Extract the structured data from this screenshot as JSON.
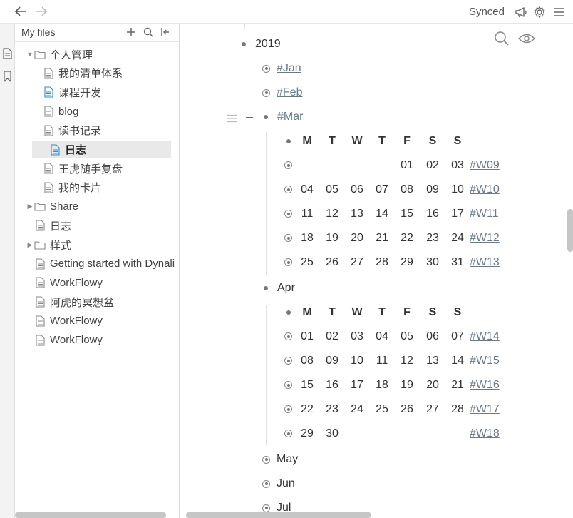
{
  "topbar": {
    "status": "Synced"
  },
  "sidebar": {
    "title": "My files",
    "tree": [
      {
        "label": "个人管理",
        "type": "folder",
        "level": 0,
        "expanded": true
      },
      {
        "label": "我的清单体系",
        "type": "file",
        "level": 1
      },
      {
        "label": "课程开发",
        "type": "file",
        "level": 1,
        "active": true
      },
      {
        "label": "blog",
        "type": "file",
        "level": 1
      },
      {
        "label": "读书记录",
        "type": "file",
        "level": 1
      },
      {
        "label": "日志",
        "type": "file",
        "level": 1,
        "selected": true
      },
      {
        "label": "王虎随手复盘",
        "type": "file",
        "level": 1
      },
      {
        "label": "我的卡片",
        "type": "file",
        "level": 1
      },
      {
        "label": "Share",
        "type": "folder",
        "level": 0,
        "expanded": false
      },
      {
        "label": "日志",
        "type": "file",
        "level": 0
      },
      {
        "label": "样式",
        "type": "folder",
        "level": 0,
        "expanded": false
      },
      {
        "label": "Getting started with Dynali",
        "type": "file",
        "level": 0
      },
      {
        "label": "WorkFlowy",
        "type": "file",
        "level": 0
      },
      {
        "label": "阿虎的冥想盆",
        "type": "file",
        "level": 0
      },
      {
        "label": "WorkFlowy",
        "type": "file",
        "level": 0
      },
      {
        "label": "WorkFlowy",
        "type": "file",
        "level": 0
      }
    ]
  },
  "outline": {
    "year": "2019",
    "months": [
      "#Jan",
      "#Feb",
      "#Mar"
    ],
    "weekday_headers": [
      "M",
      "T",
      "W",
      "T",
      "F",
      "S",
      "S"
    ],
    "march_weeks": [
      {
        "days": [
          "",
          "",
          "",
          "",
          "01",
          "02",
          "03"
        ],
        "tag": "#W09"
      },
      {
        "days": [
          "04",
          "05",
          "06",
          "07",
          "08",
          "09",
          "10"
        ],
        "tag": "#W10"
      },
      {
        "days": [
          "11",
          "12",
          "13",
          "14",
          "15",
          "16",
          "17"
        ],
        "tag": "#W11"
      },
      {
        "days": [
          "18",
          "19",
          "20",
          "21",
          "22",
          "23",
          "24"
        ],
        "tag": "#W12"
      },
      {
        "days": [
          "25",
          "26",
          "27",
          "28",
          "29",
          "30",
          "31"
        ],
        "tag": "#W13"
      }
    ],
    "april": "Apr",
    "april_weeks": [
      {
        "days": [
          "01",
          "02",
          "03",
          "04",
          "05",
          "06",
          "07"
        ],
        "tag": "#W14"
      },
      {
        "days": [
          "08",
          "09",
          "10",
          "11",
          "12",
          "13",
          "14"
        ],
        "tag": "#W15"
      },
      {
        "days": [
          "15",
          "16",
          "17",
          "18",
          "19",
          "20",
          "21"
        ],
        "tag": "#W16"
      },
      {
        "days": [
          "22",
          "23",
          "24",
          "25",
          "26",
          "27",
          "28"
        ],
        "tag": "#W17"
      },
      {
        "days": [
          "29",
          "30",
          "",
          "",
          "",
          "",
          ""
        ],
        "tag": "#W18"
      }
    ],
    "later_months": [
      "May",
      "Jun",
      "Jul"
    ]
  }
}
